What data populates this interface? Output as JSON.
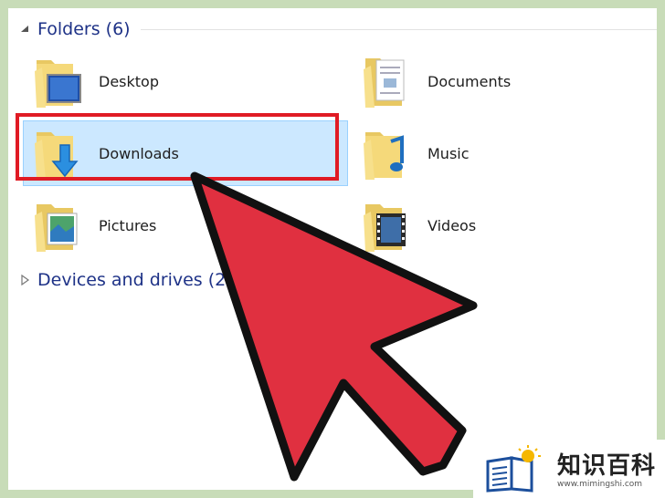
{
  "folders_group": {
    "title": "Folders (6)"
  },
  "devices_group": {
    "title": "Devices and drives (2)"
  },
  "folders": [
    {
      "label": "Desktop"
    },
    {
      "label": "Documents"
    },
    {
      "label": "Downloads"
    },
    {
      "label": "Music"
    },
    {
      "label": "Pictures"
    },
    {
      "label": "Videos"
    }
  ],
  "colors": {
    "accent_header": "#1e3287",
    "selection": "#cce8ff",
    "highlight_border": "#e01b24",
    "arrow_fill": "#e03040"
  },
  "logo": {
    "text": "知识百科",
    "url": "www.mimingshi.com"
  }
}
